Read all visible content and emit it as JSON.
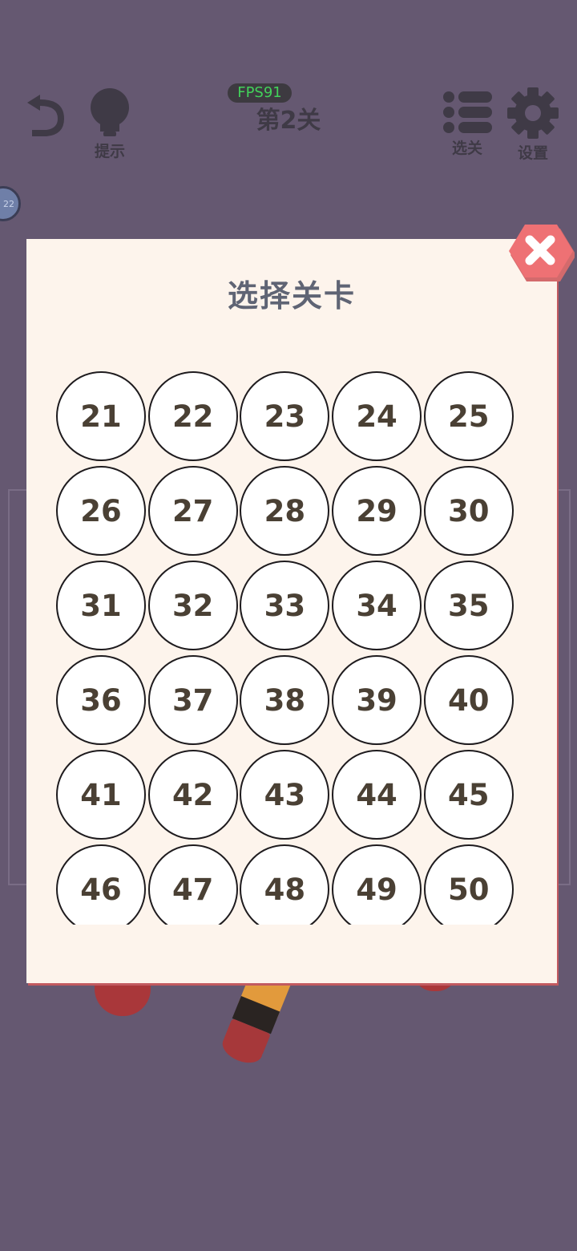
{
  "hud": {
    "fps": "FPS91",
    "level_title": "第2关",
    "hint_label": "提示",
    "levels_label": "选关",
    "settings_label": "设置",
    "side_badge": "22"
  },
  "dialog": {
    "title": "选择关卡",
    "levels": [
      "21",
      "22",
      "23",
      "24",
      "25",
      "26",
      "27",
      "28",
      "29",
      "30",
      "31",
      "32",
      "33",
      "34",
      "35",
      "36",
      "37",
      "38",
      "39",
      "40",
      "41",
      "42",
      "43",
      "44",
      "45",
      "46",
      "47",
      "48",
      "49",
      "50"
    ]
  },
  "colors": {
    "background": "#655871",
    "dialog_bg": "#fdf4ec",
    "close_button": "#ee7174",
    "fps_text": "#42d15a"
  }
}
